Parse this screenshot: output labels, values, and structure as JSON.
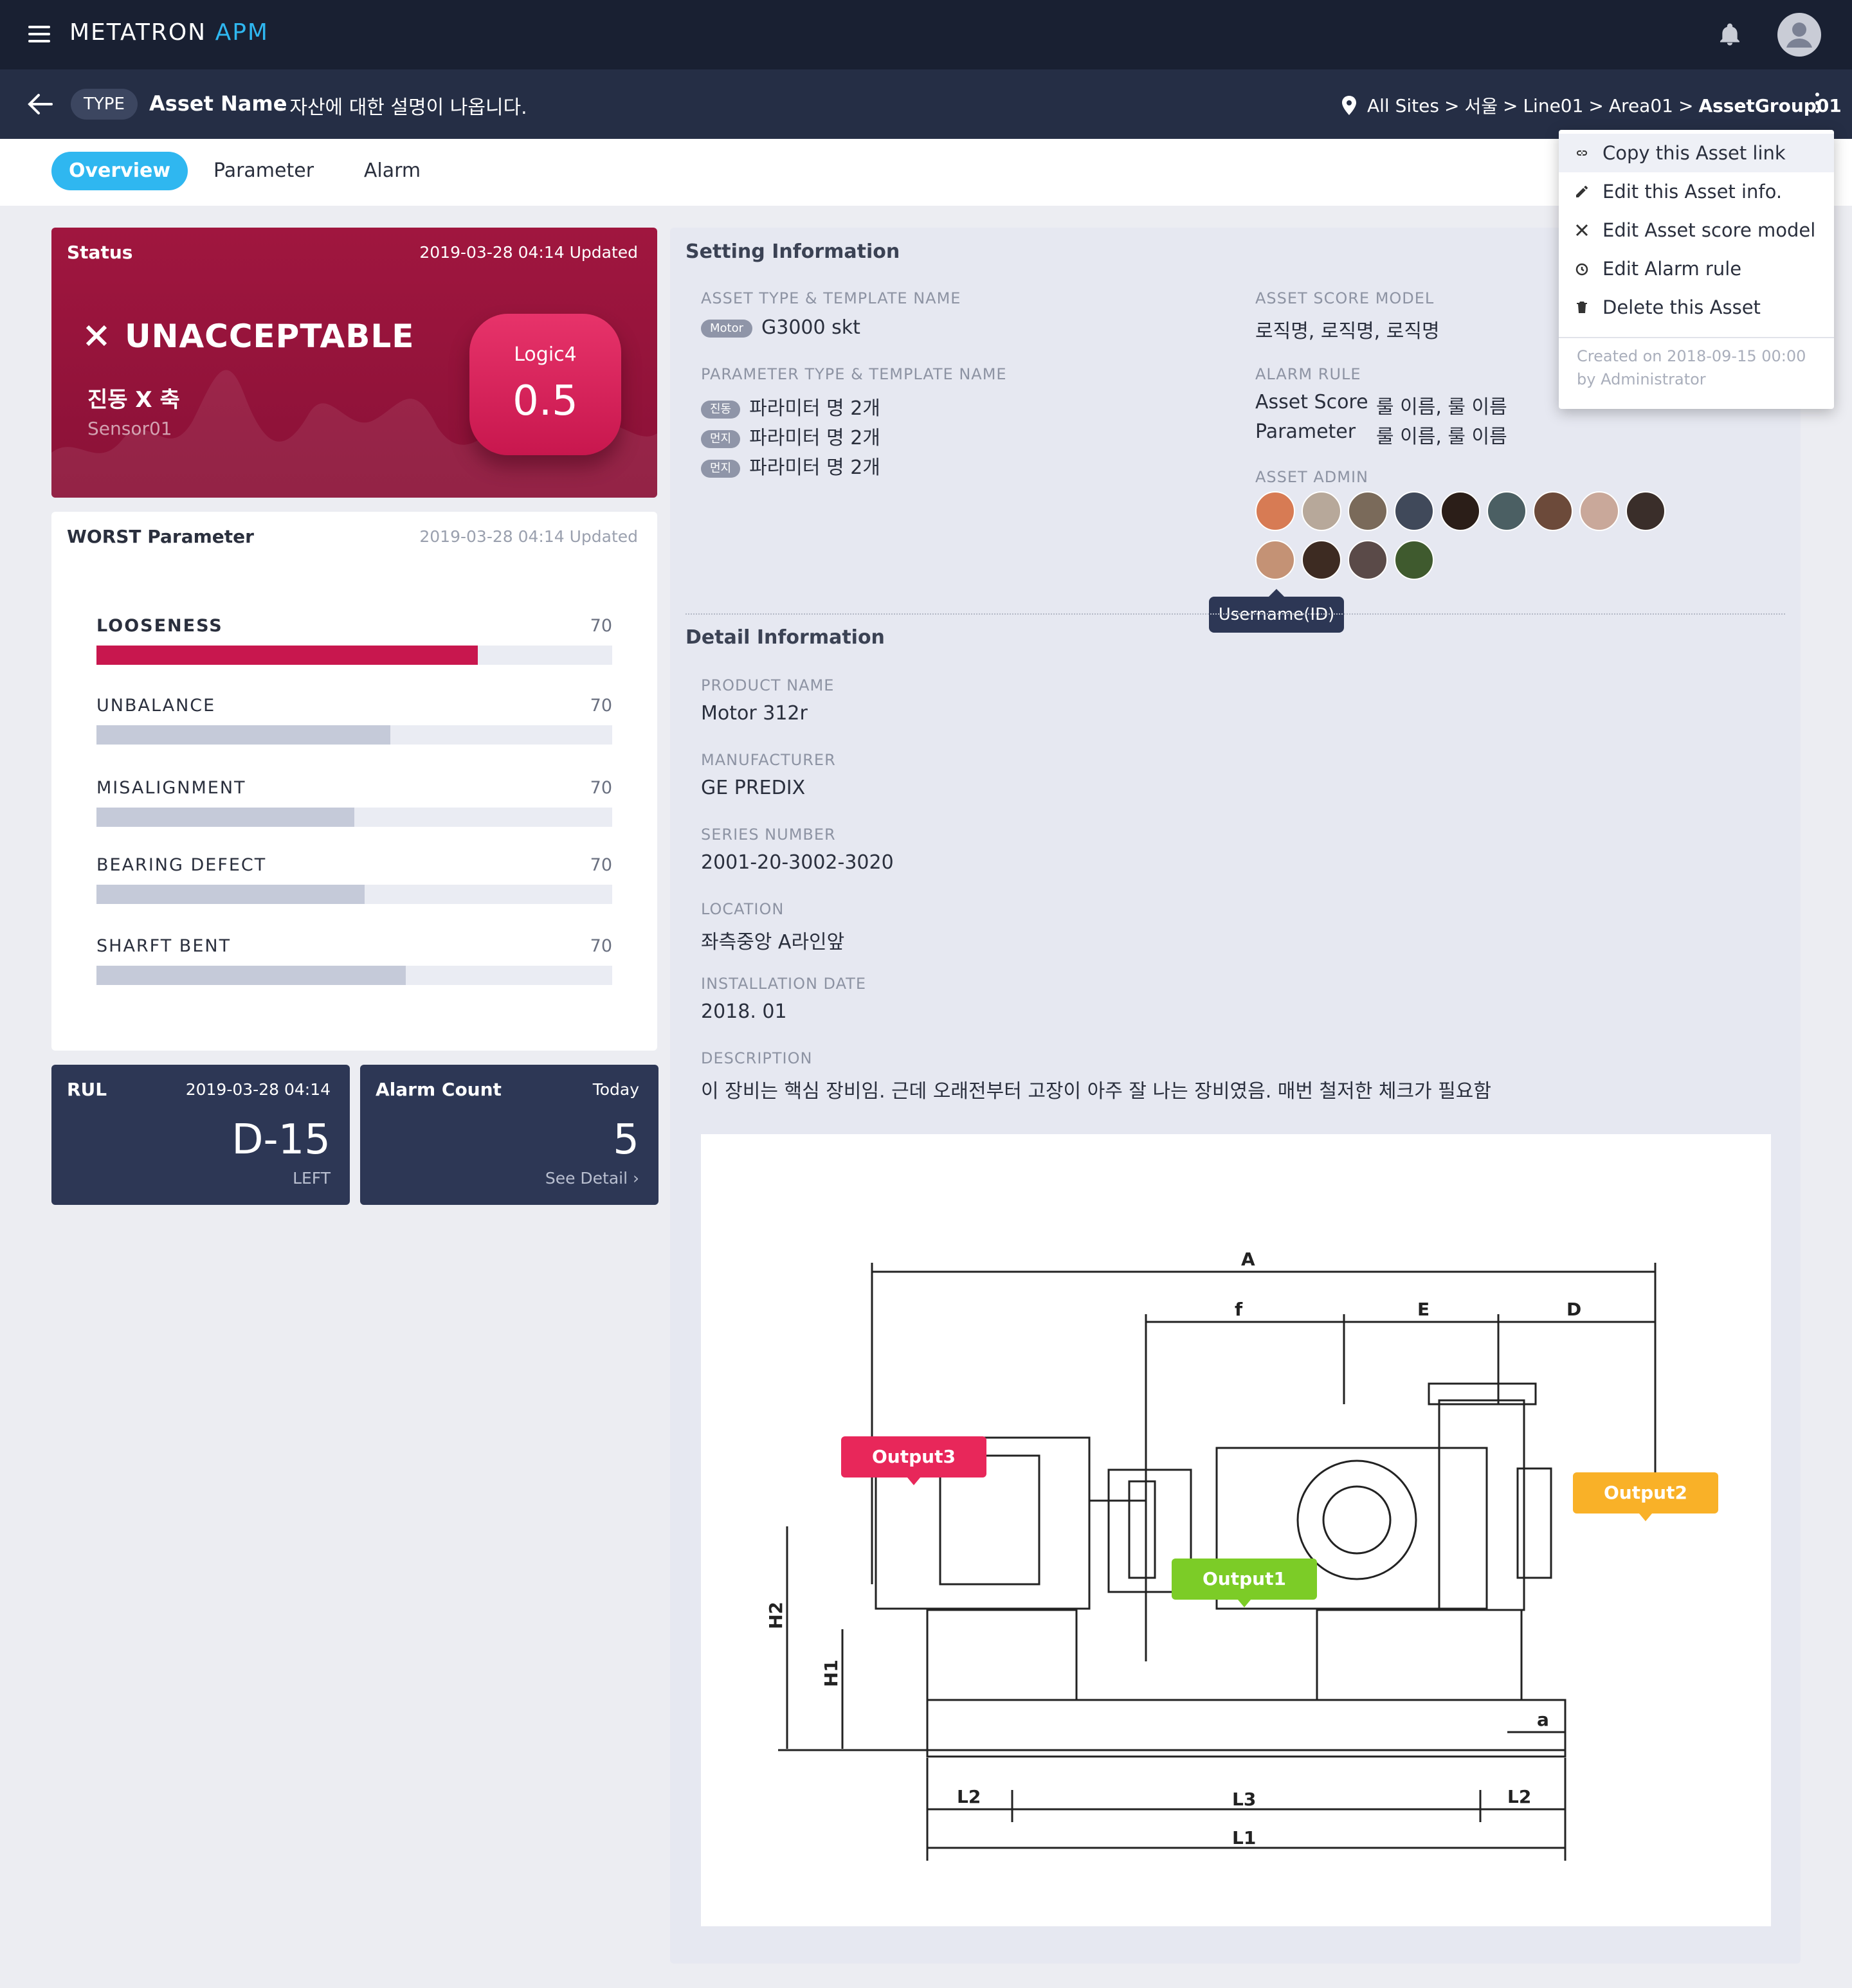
{
  "app": {
    "brand_main": "METATRON",
    "brand_accent": "APM"
  },
  "header": {
    "type_badge": "TYPE",
    "asset_name": "Asset Name",
    "asset_desc": "-  자산에 대한 설명이 나옵니다.",
    "breadcrumb": [
      "All Sites",
      ">",
      "서울",
      ">",
      "Line01",
      ">",
      "Area01",
      ">",
      "AssetGroup01"
    ]
  },
  "tabs": [
    "Overview",
    "Parameter",
    "Alarm"
  ],
  "status": {
    "title": "Status",
    "updated": "2019-03-28 04:14 Updated",
    "state": "UNACCEPTABLE",
    "param": "진동 X 축",
    "sensor": "Sensor01",
    "logic_label": "Logic4",
    "logic_value": "0.5"
  },
  "worst": {
    "title": "WORST  Parameter",
    "updated": "2019-03-28 04:14 Updated",
    "items": [
      {
        "label": "LOOSENESS",
        "value": "70",
        "fill": 0.74
      },
      {
        "label": "UNBALANCE",
        "value": "70",
        "fill": 0.57
      },
      {
        "label": "MISALIGNMENT",
        "value": "70",
        "fill": 0.5
      },
      {
        "label": "BEARING DEFECT",
        "value": "70",
        "fill": 0.52
      },
      {
        "label": "SHARFT BENT",
        "value": "70",
        "fill": 0.6
      }
    ]
  },
  "rul": {
    "title": "RUL",
    "time": "2019-03-28 04:14",
    "value": "D-15",
    "sub": "LEFT"
  },
  "alarm_count": {
    "title": "Alarm Count",
    "period": "Today",
    "value": "5",
    "link": "See Detail  ›"
  },
  "setting": {
    "title": "Setting Information",
    "asset_type_label": "ASSET TYPE & TEMPLATE NAME",
    "asset_type_tag": "Motor",
    "asset_type_value": "G3000 skt",
    "param_type_label": "PARAMETER TYPE & TEMPLATE NAME",
    "param_rows": [
      {
        "tag": "진동",
        "value": "파라미터 명 2개"
      },
      {
        "tag": "먼지",
        "value": "파라미터 명 2개"
      },
      {
        "tag": "먼지",
        "value": "파라미터 명 2개"
      }
    ],
    "score_model_label": "ASSET SCORE MODEL",
    "score_model_value": "로직명, 로직명, 로직명",
    "alarm_rule_label": "ALARM RULE",
    "alarm_rules": [
      {
        "name": "Asset Score",
        "value": "룰 이름, 룰 이름"
      },
      {
        "name": "Parameter",
        "value": "룰 이름, 룰 이름"
      }
    ],
    "admin_label": "ASSET ADMIN",
    "admin_tooltip": "Username(ID)"
  },
  "detail": {
    "title": "Detail Information",
    "fields": [
      {
        "label": "PRODUCT NAME",
        "value": "Motor 312r"
      },
      {
        "label": "MANUFACTURER",
        "value": "GE PREDIX"
      },
      {
        "label": "SERIES NUMBER",
        "value": "2001-20-3002-3020"
      },
      {
        "label": "LOCATION",
        "value": "좌측중앙 A라인앞"
      },
      {
        "label": "INSTALLATION DATE",
        "value": "2018. 01"
      },
      {
        "label": "DESCRIPTION",
        "value": "이 장비는 핵심 장비임. 근데 오래전부터 고장이 아주 잘 나는 장비였음. 매번 철저한 체크가 필요함"
      }
    ]
  },
  "diagram": {
    "outputs": [
      "Output3",
      "Output1",
      "Output2"
    ],
    "labels": [
      "A",
      "f",
      "E",
      "D",
      "H2",
      "H1",
      "a",
      "L2",
      "L3",
      "L2",
      "L1"
    ]
  },
  "menu": {
    "items": [
      "Copy this Asset link",
      "Edit this Asset info.",
      "Edit Asset score model",
      "Edit Alarm rule",
      "Delete this Asset"
    ],
    "meta": "Created on 2018-09-15 00:00 by Administrator"
  },
  "colors": {
    "accent": "#2fb7f0",
    "status_bg": "#a0163f",
    "hot_bar": "#c8174e",
    "navy": "#192032",
    "output_red": "#e8275a",
    "output_green": "#7ccc27",
    "output_orange": "#f9b128"
  }
}
